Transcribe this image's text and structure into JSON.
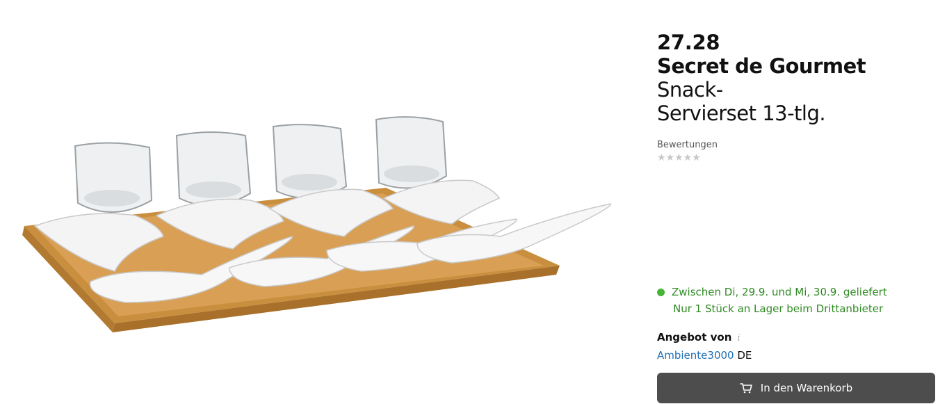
{
  "product": {
    "price": "27.28",
    "brand": "Secret de Gourmet",
    "name_line1": " Snack-",
    "name_line2": "Servierset 13-tlg.",
    "image_icon": "product-photo"
  },
  "ratings": {
    "label": "Bewertungen",
    "stars_filled": 0,
    "stars_total": 5,
    "stars_text": "★★★★★"
  },
  "delivery": {
    "status_color": "#45b534",
    "line1": "Zwischen Di, 29.9. und Mi, 30.9. geliefert",
    "line2": "Nur 1 Stück an Lager beim Drittanbieter"
  },
  "offer": {
    "label": "Angebot von",
    "info_icon": "i",
    "seller": "Ambiente3000",
    "country": " DE"
  },
  "cart": {
    "button_label": "In den Warenkorb",
    "icon": "cart-icon"
  }
}
